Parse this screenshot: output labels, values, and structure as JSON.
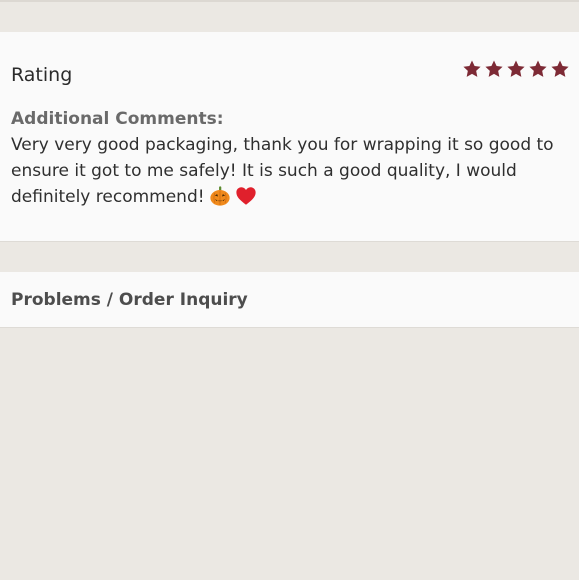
{
  "rating_section": {
    "title": "Rating",
    "stars": 5,
    "max_stars": 5,
    "star_color": "#7d2a35",
    "comments_heading": "Additional Comments:",
    "comment_lines": [
      "Very very good packaging, thank you for wrapping it so good to",
      "ensure it got to me safely! It is such a good quality, I would",
      "definitely recommend!"
    ],
    "emojis": [
      "jack-o-lantern-icon",
      "heart-icon"
    ]
  },
  "problems_section": {
    "title": "Problems / Order Inquiry"
  },
  "colors": {
    "background": "#ebe8e3",
    "card": "#fafafa",
    "heart": "#e0202c",
    "pumpkin": "#f08a1c"
  }
}
